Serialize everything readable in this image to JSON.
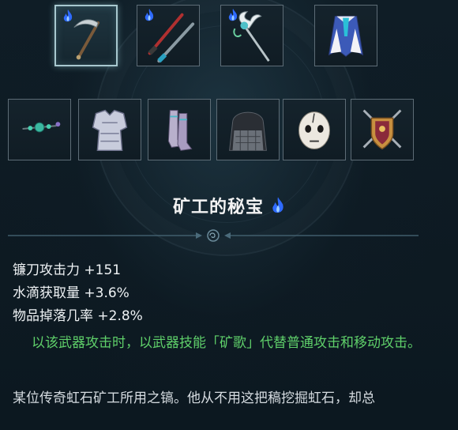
{
  "title": "矿工的秘宝",
  "stats": [
    "镰刀攻击力 +151",
    "水滴获取量 +3.6%",
    "物品掉落几率 +2.8%"
  ],
  "ability": "以该武器攻击时，以武器技能「矿歌」代替普通攻击和移动攻击。",
  "lore": "某位传奇虹石矿工所用之镐。他从不用这把稿挖掘虹石，却总",
  "colors": {
    "ability_text": "#5fd06a",
    "flame": "#2f6bff",
    "selected_border": "#a8c8cf"
  },
  "slots_row1": [
    {
      "icon": "scythe-icon",
      "flame": true,
      "selected": true
    },
    {
      "icon": "twin-swords-icon",
      "flame": true,
      "selected": false
    },
    {
      "icon": "ornate-staff-icon",
      "flame": true,
      "selected": false
    },
    {
      "icon": "cape-icon",
      "flame": false,
      "selected": false
    }
  ],
  "slots_row2": [
    {
      "icon": "amulet-icon"
    },
    {
      "icon": "armor-icon"
    },
    {
      "icon": "boots-icon"
    },
    {
      "icon": "hood-icon"
    },
    {
      "icon": "mask-icon"
    },
    {
      "icon": "shield-icon"
    }
  ]
}
